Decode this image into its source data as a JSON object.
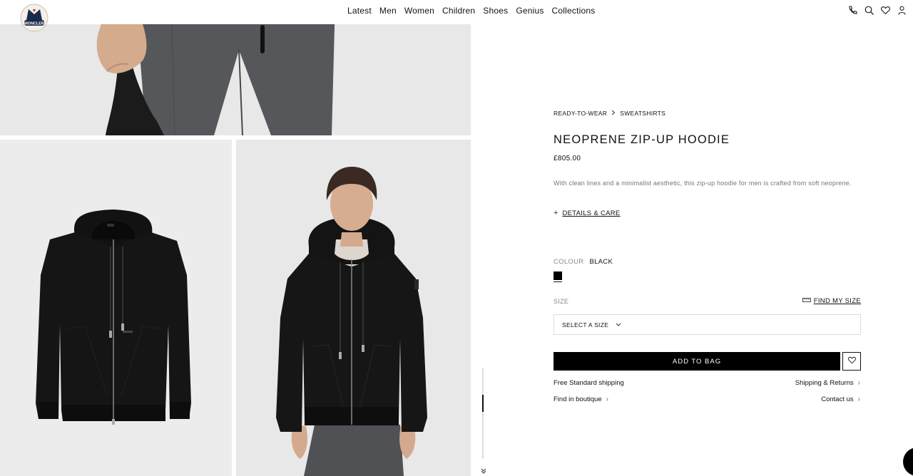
{
  "brand": {
    "logo_text": "MONCLER"
  },
  "nav": {
    "items": [
      "Latest",
      "Men",
      "Women",
      "Children",
      "Shoes",
      "Genius",
      "Collections"
    ]
  },
  "tools": {
    "icons": [
      "phone-icon",
      "search-icon",
      "heart-icon",
      "user-icon"
    ]
  },
  "product": {
    "breadcrumb": [
      "READY-TO-WEAR",
      "SWEATSHIRTS"
    ],
    "title": "NEOPRENE ZIP-UP HOODIE",
    "price": "£805.00",
    "description": "With clean lines and a minimalist aesthetic, this zip-up hoodie for men is crafted from soft neoprene.",
    "details_label": "DETAILS & CARE",
    "colour_label": "COLOUR",
    "colour_value": "BLACK",
    "colour_hex": "#000000",
    "size_label": "SIZE",
    "find_size_label": "FIND MY SIZE",
    "select_placeholder": "SELECT A SIZE",
    "add_to_bag_label": "ADD TO BAG",
    "shipping_label": "Free Standard shipping",
    "shipping_returns_label": "Shipping & Returns",
    "boutique_label": "Find in boutique",
    "contact_label": "Contact us"
  }
}
